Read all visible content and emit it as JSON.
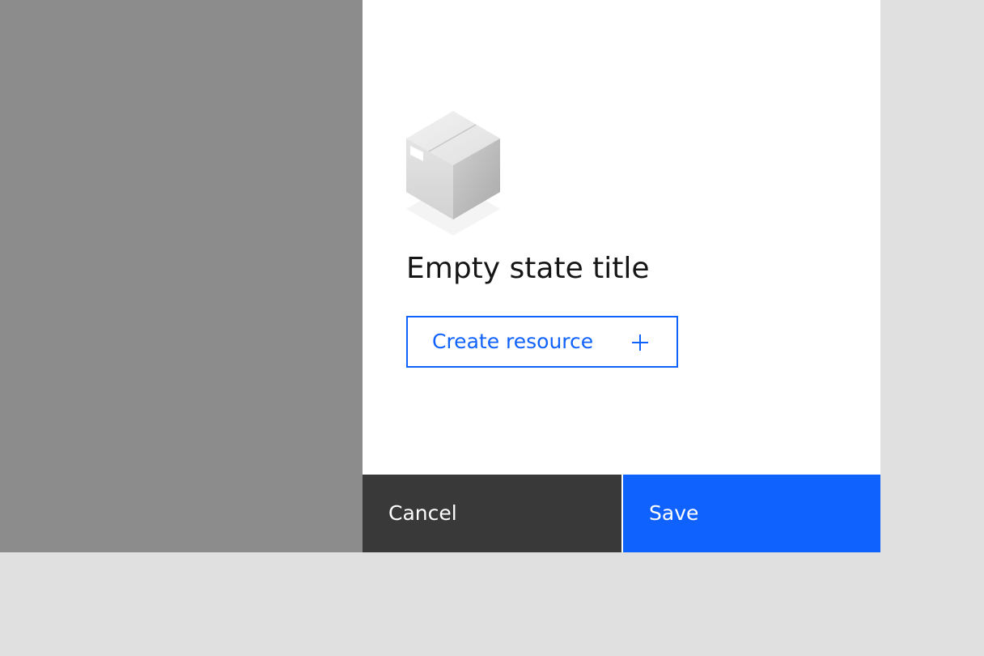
{
  "empty_state": {
    "illustration": "empty-box-illustration",
    "title": "Empty state title",
    "action_label": "Create resource",
    "action_icon": "plus-icon"
  },
  "footer": {
    "cancel_label": "Cancel",
    "save_label": "Save"
  },
  "colors": {
    "primary": "#0f62fe",
    "secondary": "#393939",
    "overlay": "#8c8c8c",
    "background": "#e0e0e0",
    "text": "#161616"
  }
}
